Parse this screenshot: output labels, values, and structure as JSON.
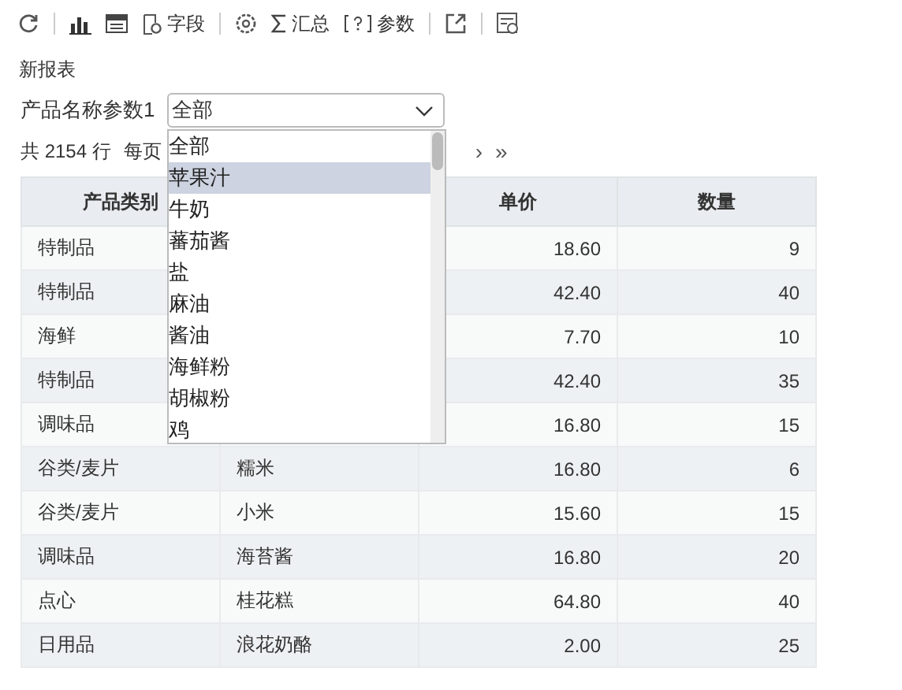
{
  "toolbar": [
    {
      "kind": "refresh"
    },
    {
      "kind": "sep"
    },
    {
      "kind": "chart"
    },
    {
      "kind": "table"
    },
    {
      "kind": "fields",
      "label": "字段"
    },
    {
      "kind": "sep"
    },
    {
      "kind": "gear"
    },
    {
      "kind": "sum",
      "label": "汇总"
    },
    {
      "kind": "param",
      "label": "参数"
    },
    {
      "kind": "sep"
    },
    {
      "kind": "export"
    },
    {
      "kind": "sep"
    },
    {
      "kind": "report"
    }
  ],
  "report_title": "新报表",
  "parameter": {
    "label": "产品名称参数1",
    "value": "全部"
  },
  "dropdown": {
    "options": [
      {
        "label": "全部",
        "selected": false
      },
      {
        "label": "苹果汁",
        "selected": true
      },
      {
        "label": "牛奶",
        "selected": false
      },
      {
        "label": "蕃茄酱",
        "selected": false
      },
      {
        "label": "盐",
        "selected": false
      },
      {
        "label": "麻油",
        "selected": false
      },
      {
        "label": "酱油",
        "selected": false
      },
      {
        "label": "海鲜粉",
        "selected": false
      },
      {
        "label": "胡椒粉",
        "selected": false
      },
      {
        "label": "鸡",
        "selected": false
      }
    ]
  },
  "pager": {
    "total": "共 2154 行",
    "per_page": "每页",
    "next": "›",
    "last": "»"
  },
  "table": {
    "columns": [
      "产品类别",
      null,
      "单价",
      "数量"
    ],
    "rows": [
      [
        "特制品",
        null,
        "18.60",
        "9"
      ],
      [
        "特制品",
        null,
        "42.40",
        "40"
      ],
      [
        "海鲜",
        null,
        "7.70",
        "10"
      ],
      [
        "特制品",
        null,
        "42.40",
        "35"
      ],
      [
        "调味品",
        null,
        "16.80",
        "15"
      ],
      [
        "谷类/麦片",
        "糯米",
        "16.80",
        "6"
      ],
      [
        "谷类/麦片",
        "小米",
        "15.60",
        "15"
      ],
      [
        "调味品",
        "海苔酱",
        "16.80",
        "20"
      ],
      [
        "点心",
        "桂花糕",
        "64.80",
        "40"
      ],
      [
        "日用品",
        "浪花奶酪",
        "2.00",
        "25"
      ]
    ]
  }
}
